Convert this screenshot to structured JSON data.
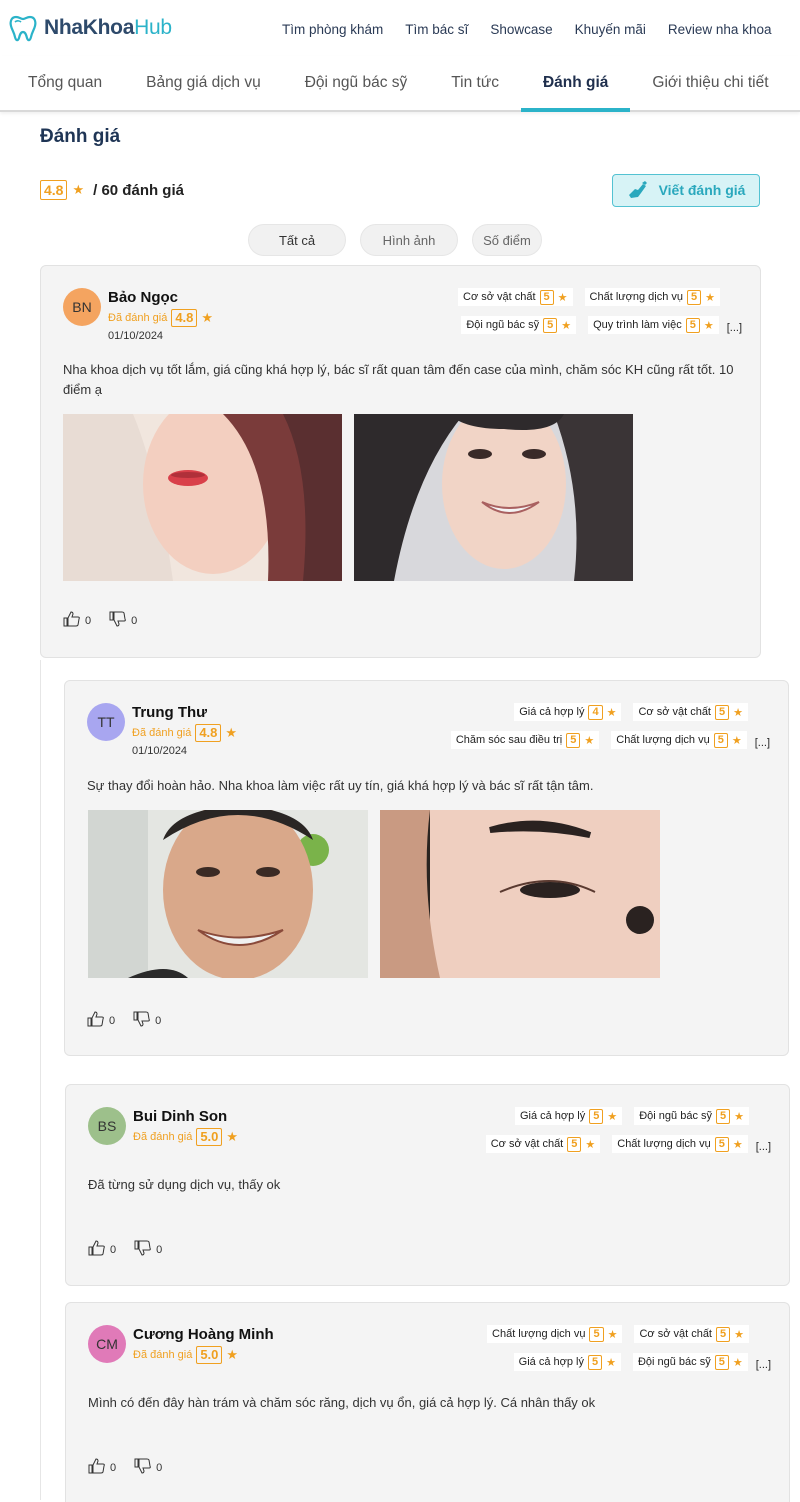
{
  "brand": {
    "name_part1": "NhaKhoa",
    "name_part2": "Hub",
    "accent": "#2bb3c9"
  },
  "topnav": [
    "Tìm phòng khám",
    "Tìm bác sĩ",
    "Showcase",
    "Khuyến mãi",
    "Review nha khoa"
  ],
  "tabs": [
    "Tổng quan",
    "Bảng giá dịch vụ",
    "Đội ngũ bác sỹ",
    "Tin tức",
    "Đánh giá",
    "Giới thiệu chi tiết"
  ],
  "active_tab": "Đánh giá",
  "section": {
    "title": "Đánh giá",
    "avg": "4.8",
    "count_text": "/ 60 đánh giá",
    "write_button": "Viết đánh giá",
    "filters": [
      "Tất cả",
      "Hình ảnh",
      "Số điểm"
    ]
  },
  "reviews": [
    {
      "initials": "BN",
      "avatar_color": "#f4a460",
      "name": "Bảo Ngọc",
      "rated_label": "Đã đánh giá",
      "score": "4.8",
      "date": "01/10/2024",
      "criteria_row1": [
        {
          "label": "Cơ sở vật chất",
          "score": "5"
        },
        {
          "label": "Chất lượng dịch vụ",
          "score": "5"
        }
      ],
      "criteria_row2": [
        {
          "label": "Đội ngũ bác sỹ",
          "score": "5"
        },
        {
          "label": "Quy trình làm việc",
          "score": "5"
        }
      ],
      "more": "[...]",
      "text": "Nha khoa dịch vụ tốt lắm, giá cũng khá hợp lý, bác sĩ rất quan tâm đến case của mình, chăm sóc KH cũng rất tốt. 10 điểm ạ",
      "likes": "0",
      "dislikes": "0"
    },
    {
      "initials": "TT",
      "avatar_color": "#a8a6f0",
      "name": "Trung Thư",
      "rated_label": "Đã đánh giá",
      "score": "4.8",
      "date": "01/10/2024",
      "criteria_row1": [
        {
          "label": "Giá cả hợp lý",
          "score": "4"
        },
        {
          "label": "Cơ sở vật chất",
          "score": "5"
        }
      ],
      "criteria_row2": [
        {
          "label": "Chăm sóc sau điều trị",
          "score": "5"
        },
        {
          "label": "Chất lượng dịch vụ",
          "score": "5"
        }
      ],
      "more": "[...]",
      "text": "Sự thay đổi hoàn hảo. Nha khoa làm việc rất uy tín, giá khá hợp lý và bác sĩ rất tận tâm.",
      "likes": "0",
      "dislikes": "0"
    },
    {
      "initials": "BS",
      "avatar_color": "#9dc08b",
      "name": "Bui Dinh Son",
      "rated_label": "Đã đánh giá",
      "score": "5.0",
      "date": "",
      "criteria_row1": [
        {
          "label": "Giá cả hợp lý",
          "score": "5"
        },
        {
          "label": "Đội ngũ bác sỹ",
          "score": "5"
        }
      ],
      "criteria_row2": [
        {
          "label": "Cơ sở vật chất",
          "score": "5"
        },
        {
          "label": "Chất lượng dịch vụ",
          "score": "5"
        }
      ],
      "more": "[...]",
      "text": "Đã từng sử dụng dịch vụ, thấy ok",
      "likes": "0",
      "dislikes": "0"
    },
    {
      "initials": "CM",
      "avatar_color": "#e07ab8",
      "name": "Cương Hoàng Minh",
      "rated_label": "Đã đánh giá",
      "score": "5.0",
      "date": "",
      "criteria_row1": [
        {
          "label": "Chất lượng dịch vụ",
          "score": "5"
        },
        {
          "label": "Cơ sở vật chất",
          "score": "5"
        }
      ],
      "criteria_row2": [
        {
          "label": "Giá cả hợp lý",
          "score": "5"
        },
        {
          "label": "Đội ngũ bác sỹ",
          "score": "5"
        }
      ],
      "more": "[...]",
      "text": "Mình có đến đây hàn trám và chăm sóc răng, dịch vụ ổn, giá cả hợp lý. Cá nhân thấy ok",
      "likes": "0",
      "dislikes": "0"
    }
  ]
}
